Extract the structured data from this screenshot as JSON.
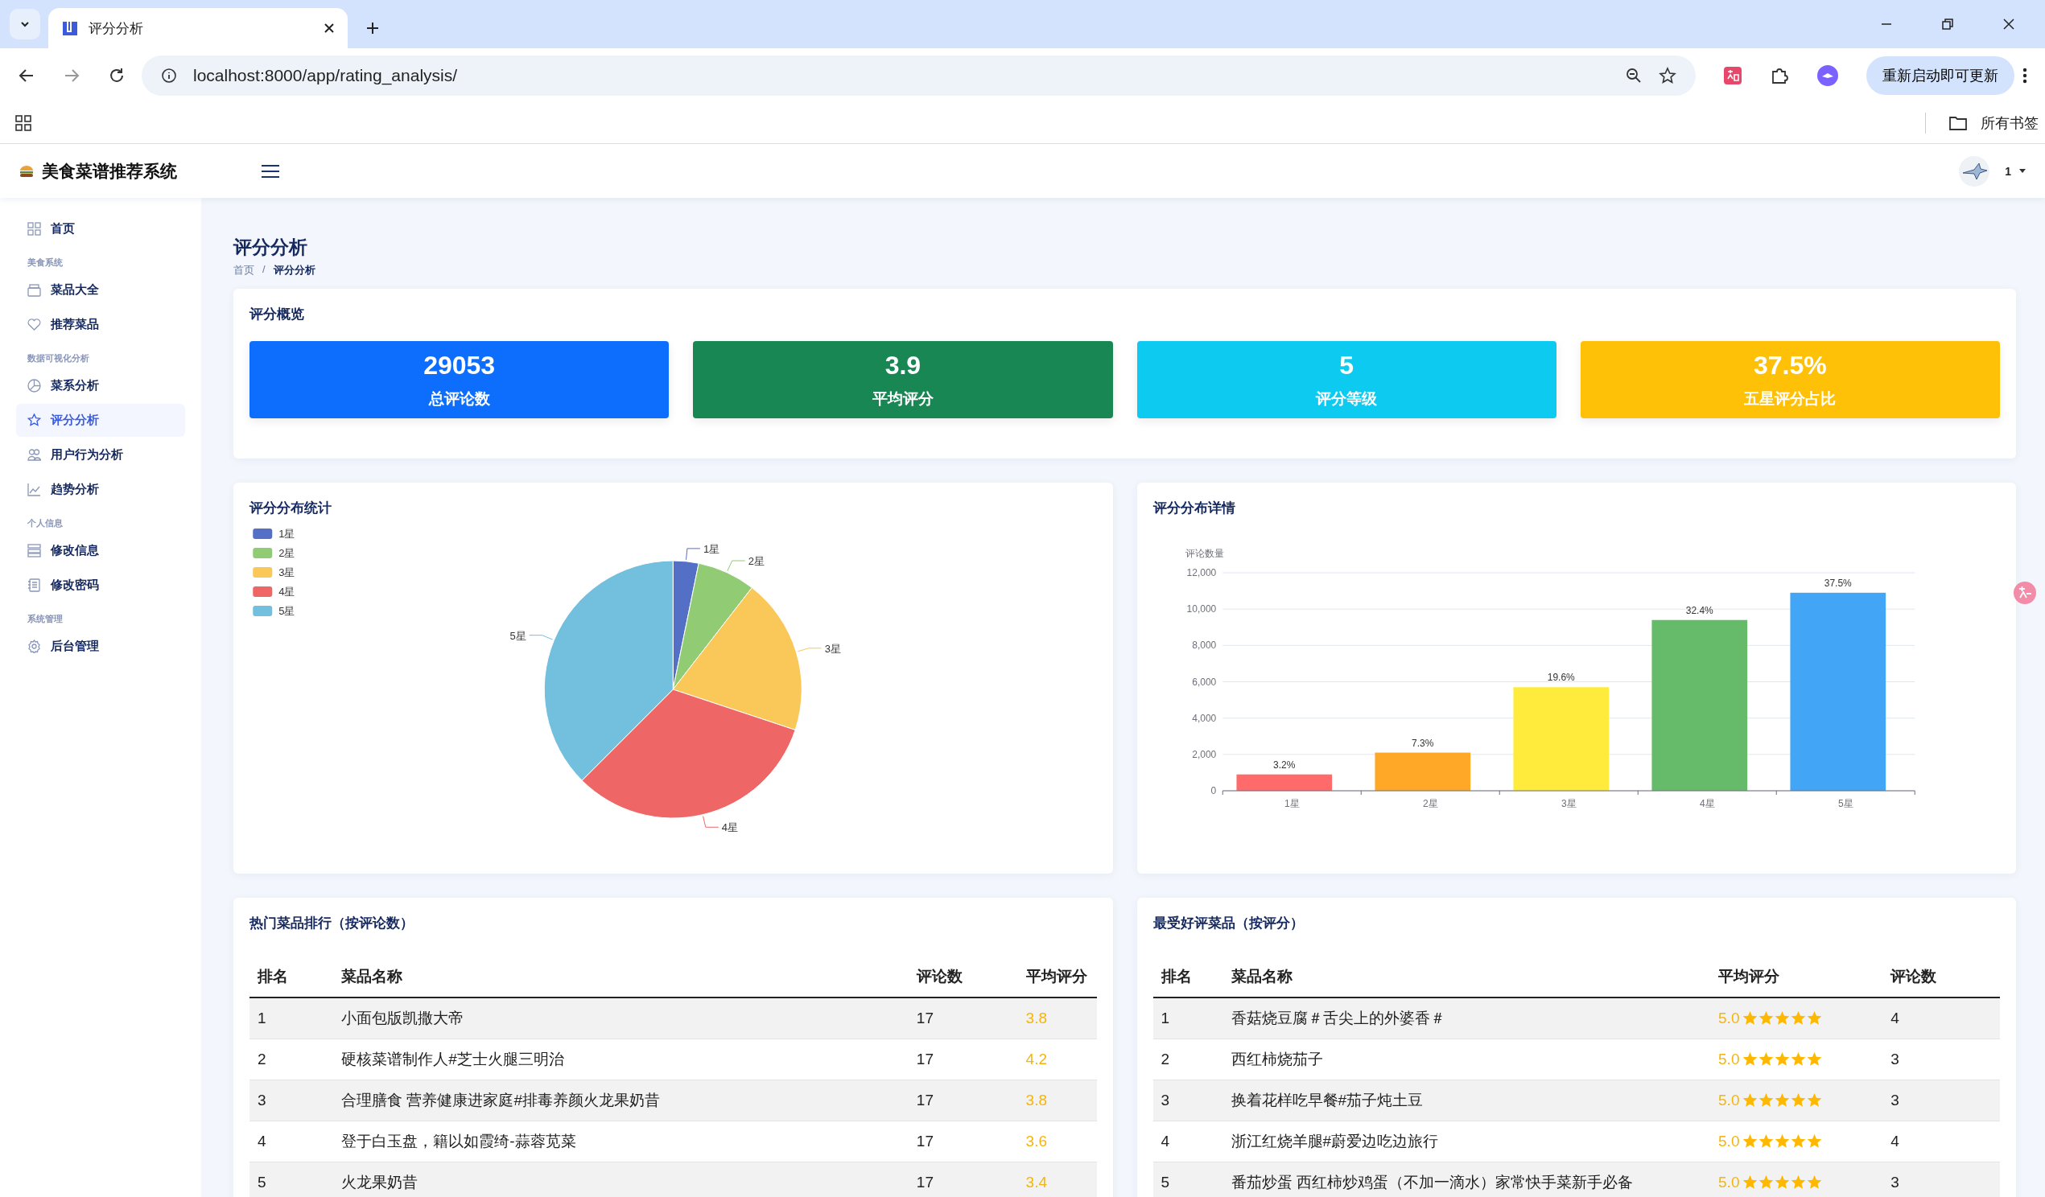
{
  "browser": {
    "tab_title": "评分分析",
    "address": "localhost:8000/app/rating_analysis/",
    "update_button": "重新启动即可更新",
    "bookmarks_label": "所有书签"
  },
  "app": {
    "title": "美食菜谱推荐系统",
    "user": "1"
  },
  "sidebar": {
    "items": [
      {
        "kind": "item",
        "label": "首页",
        "selected": false
      },
      {
        "kind": "section",
        "label": "美食系统"
      },
      {
        "kind": "item",
        "label": "菜品大全",
        "selected": false
      },
      {
        "kind": "item",
        "label": "推荐菜品",
        "selected": false
      },
      {
        "kind": "section",
        "label": "数据可视化分析"
      },
      {
        "kind": "item",
        "label": "菜系分析",
        "selected": false
      },
      {
        "kind": "item",
        "label": "评分分析",
        "selected": true
      },
      {
        "kind": "item",
        "label": "用户行为分析",
        "selected": false
      },
      {
        "kind": "item",
        "label": "趋势分析",
        "selected": false
      },
      {
        "kind": "section",
        "label": "个人信息"
      },
      {
        "kind": "item",
        "label": "修改信息",
        "selected": false
      },
      {
        "kind": "item",
        "label": "修改密码",
        "selected": false
      },
      {
        "kind": "section",
        "label": "系统管理"
      },
      {
        "kind": "item",
        "label": "后台管理",
        "selected": false
      }
    ]
  },
  "page": {
    "title": "评分分析",
    "breadcrumb": [
      "首页",
      "评分分析"
    ],
    "breadcrumb_separator": "/"
  },
  "overview": {
    "title": "评分概览",
    "stats": [
      {
        "value": "29053",
        "label": "总评论数",
        "color": "#0d6efd"
      },
      {
        "value": "3.9",
        "label": "平均评分",
        "color": "#198754"
      },
      {
        "value": "5",
        "label": "评分等级",
        "color": "#0dcaf0"
      },
      {
        "value": "37.5%",
        "label": "五星评分占比",
        "color": "#ffc107"
      }
    ]
  },
  "pie_panel": {
    "title": "评分分布统计",
    "legend": [
      {
        "label": "1星",
        "color": "#5470c6"
      },
      {
        "label": "2星",
        "color": "#91cc75"
      },
      {
        "label": "3星",
        "color": "#fac858"
      },
      {
        "label": "4星",
        "color": "#ee6666"
      },
      {
        "label": "5星",
        "color": "#73c0de"
      }
    ],
    "chart_data": {
      "type": "pie",
      "categories": [
        "1星",
        "2星",
        "3星",
        "4星",
        "5星"
      ],
      "values": [
        3.2,
        7.3,
        19.6,
        32.4,
        37.5
      ]
    }
  },
  "bar_panel": {
    "title": "评分分布详情",
    "chart_data": {
      "type": "bar",
      "ylabel": "评论数量",
      "categories": [
        "1星",
        "2星",
        "3星",
        "4星",
        "5星"
      ],
      "values": [
        900,
        2100,
        5700,
        9400,
        10900
      ],
      "ylim": [
        0,
        12000
      ],
      "grid": true,
      "yticks": [
        {
          "value": 0,
          "label": "0"
        },
        {
          "value": 2000,
          "label": "2,000"
        },
        {
          "value": 4000,
          "label": "4,000"
        },
        {
          "value": 6000,
          "label": "6,000"
        },
        {
          "value": 8000,
          "label": "8,000"
        },
        {
          "value": 10000,
          "label": "10,000"
        },
        {
          "value": 12000,
          "label": "12,000"
        }
      ]
    },
    "share_labels": [
      "3.2%",
      "7.3%",
      "19.6%",
      "32.4%",
      "37.5%"
    ]
  },
  "hot_table": {
    "title": "热门菜品排行（按评论数）",
    "columns": [
      "排名",
      "菜品名称",
      "评论数",
      "平均评分"
    ],
    "rows": [
      {
        "rank": "1",
        "name": "小面包版凯撒大帝",
        "count": "17",
        "rating": "3.8"
      },
      {
        "rank": "2",
        "name": "硬核菜谱制作人#芝士火腿三明治",
        "count": "17",
        "rating": "4.2"
      },
      {
        "rank": "3",
        "name": "合理膳食 营养健康进家庭#排毒养颜火龙果奶昔",
        "count": "17",
        "rating": "3.8"
      },
      {
        "rank": "4",
        "name": "登于白玉盘，籍以如霞绮-蒜蓉苋菜",
        "count": "17",
        "rating": "3.6"
      },
      {
        "rank": "5",
        "name": "火龙果奶昔",
        "count": "17",
        "rating": "3.4"
      }
    ]
  },
  "fav_table": {
    "title": "最受好评菜品（按评分）",
    "columns": [
      "排名",
      "菜品名称",
      "平均评分",
      "评论数"
    ],
    "rows": [
      {
        "rank": "1",
        "name": "香菇烧豆腐＃舌尖上的外婆香＃",
        "rating": "5.0",
        "stars": 5,
        "count": "4"
      },
      {
        "rank": "2",
        "name": "西红柿烧茄子",
        "rating": "5.0",
        "stars": 5,
        "count": "3"
      },
      {
        "rank": "3",
        "name": "换着花样吃早餐#茄子炖土豆",
        "rating": "5.0",
        "stars": 5,
        "count": "3"
      },
      {
        "rank": "4",
        "name": "浙江红烧羊腿#蔚爱边吃边旅行",
        "rating": "5.0",
        "stars": 5,
        "count": "4"
      },
      {
        "rank": "5",
        "name": "番茄炒蛋 西红柿炒鸡蛋（不加一滴水）家常快手菜新手必备",
        "rating": "5.0",
        "stars": 5,
        "count": "3"
      }
    ]
  }
}
